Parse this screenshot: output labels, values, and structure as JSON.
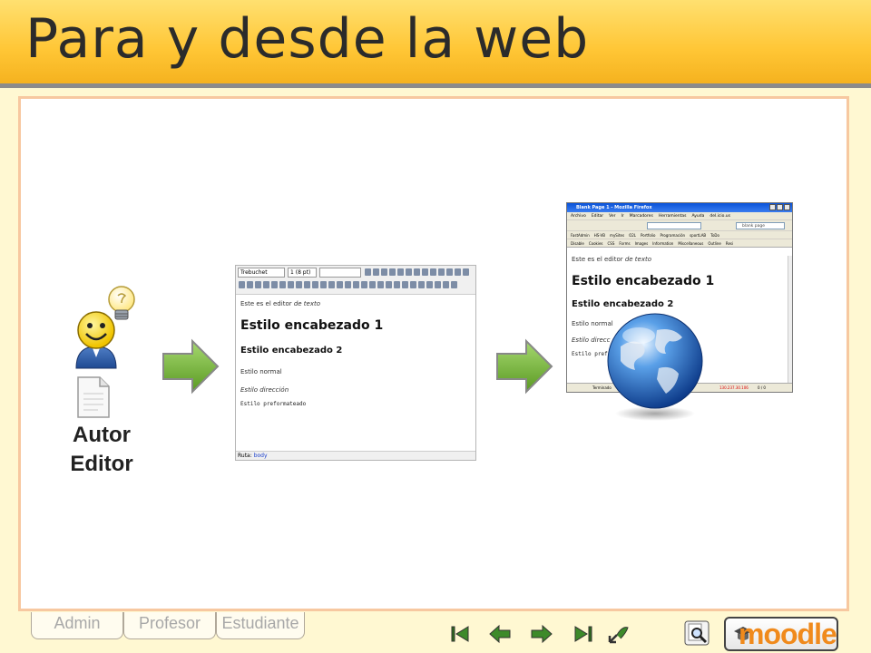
{
  "header": {
    "title": "Para y desde la web"
  },
  "author": {
    "label_line1": "Autor",
    "label_line2": "Editor"
  },
  "editor": {
    "font_select": "Trebuchet",
    "size_select": "1 (8 pt)",
    "content": {
      "intro": "Este es el editor ",
      "intro_em": "de texto",
      "heading1": "Estilo encabezado 1",
      "heading2": "Estilo encabezado 2",
      "normal": "Estilo normal",
      "address": "Estilo dirección",
      "preformatted": "Estilo preformateado"
    },
    "status_label": "Ruta:",
    "status_link": "body"
  },
  "browser": {
    "title": "Blank Page 1 - Mozilla Firefox",
    "menu": [
      "Archivo",
      "Editar",
      "Ver",
      "Ir",
      "Marcadores",
      "Herramientas",
      "Ayuda",
      "del.icio.us"
    ],
    "search_placeholder": "blank page",
    "bookmarks": [
      "FastAdmin",
      "HS-VB",
      "mySites",
      "O2L",
      "Portfolio",
      "Programación",
      "sportLAB",
      "ToDo"
    ],
    "toolbar": [
      "Disable",
      "Cookies",
      "CSS",
      "Forms",
      "Images",
      "Information",
      "Miscellaneous",
      "Outline",
      "Resi"
    ],
    "content": {
      "intro": "Este es el editor ",
      "intro_em": "de texto",
      "heading1": "Estilo encabezado 1",
      "heading2": "Estilo encabezado 2",
      "normal": "Estilo normal",
      "address": "Estilo direcc",
      "preformatted": "Estilo pref"
    },
    "status": {
      "left": "Terminado",
      "ip": "130.237.30.106",
      "right": "0 / 0"
    }
  },
  "tabs": [
    "Admin",
    "Profesor",
    "Estudiante"
  ],
  "brand": "moodle",
  "colors": {
    "header": "#ffc635",
    "panel_border": "#f7c8a0",
    "moodle_orange": "#f08a1c",
    "arrow_green": "#6fb12e"
  }
}
